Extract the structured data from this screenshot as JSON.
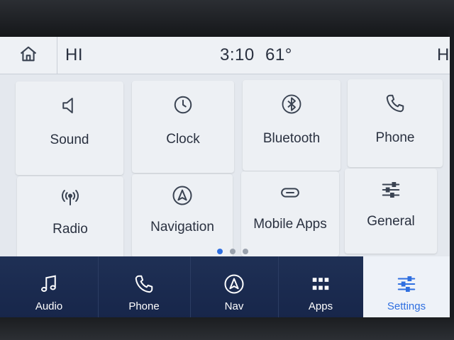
{
  "status_bar": {
    "left_greeting": "HI",
    "time": "3:10",
    "temperature": "61°",
    "right_greeting": "HI"
  },
  "settings_tiles": [
    {
      "label": "Sound",
      "icon": "speaker-icon"
    },
    {
      "label": "Clock",
      "icon": "clock-icon"
    },
    {
      "label": "Bluetooth",
      "icon": "bluetooth-icon"
    },
    {
      "label": "Phone",
      "icon": "phone-icon"
    },
    {
      "label": "Radio",
      "icon": "antenna-icon"
    },
    {
      "label": "Navigation",
      "icon": "navigation-arrow-icon"
    },
    {
      "label": "Mobile Apps",
      "icon": "link-icon"
    },
    {
      "label": "General",
      "icon": "sliders-icon"
    }
  ],
  "pagination": {
    "pages": 3,
    "current_page": 1
  },
  "bottom_nav": [
    {
      "label": "Audio",
      "icon": "music-note-icon",
      "active": false
    },
    {
      "label": "Phone",
      "icon": "phone-icon",
      "active": false
    },
    {
      "label": "Nav",
      "icon": "navigation-arrow-icon",
      "active": false
    },
    {
      "label": "Apps",
      "icon": "grid-icon",
      "active": false
    },
    {
      "label": "Settings",
      "icon": "sliders-icon",
      "active": true
    }
  ],
  "colors": {
    "accent": "#2f6fe0",
    "nav_background": "#1f3055",
    "screen_background": "#e4e8ee"
  }
}
